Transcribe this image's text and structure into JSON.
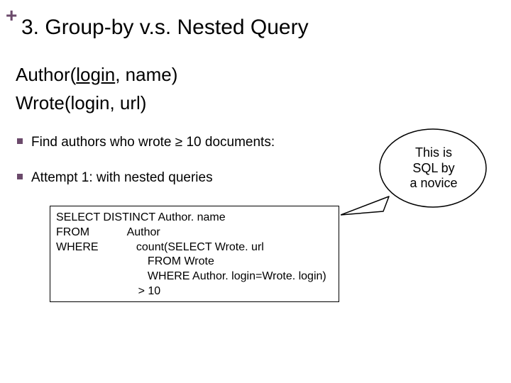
{
  "plus_symbol": "+",
  "title": "3. Group-by v.s. Nested Query",
  "schema": {
    "line1_prefix": "Author(",
    "line1_ul": "login",
    "line1_suffix": ", name)",
    "line2": "Wrote(login, url)"
  },
  "bullets": {
    "b1": "Find authors who wrote ≥ 10 documents:",
    "b2": "Attempt 1: with nested queries"
  },
  "code": "SELECT DISTINCT Author. name\nFROM            Author\nWHERE            count(SELECT Wrote. url\n                             FROM Wrote\n                             WHERE Author. login=Wrote. login)\n                          > 10",
  "note": {
    "l1": "This is",
    "l2": "SQL by",
    "l3": "a novice"
  }
}
